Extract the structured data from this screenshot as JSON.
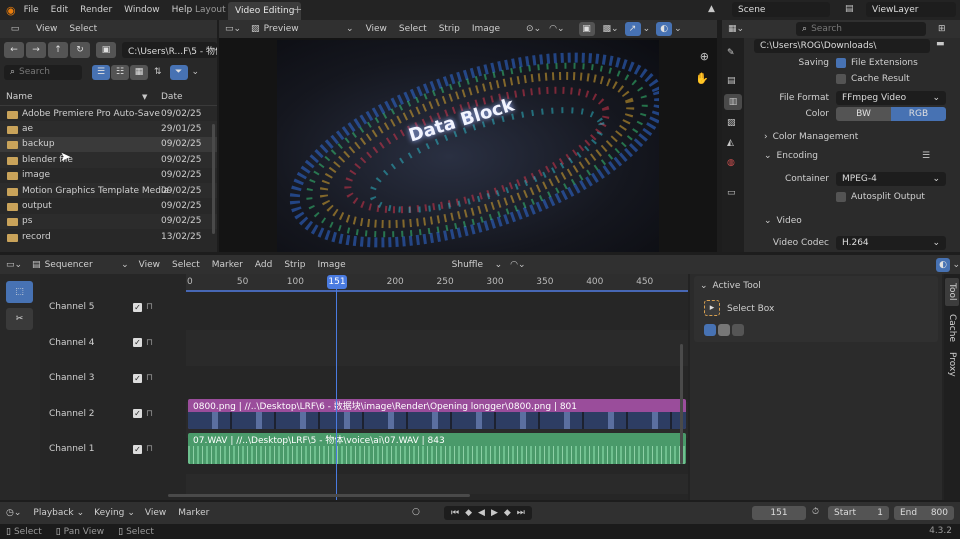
{
  "topbar": {
    "menus": [
      "File",
      "Edit",
      "Render",
      "Window",
      "Help"
    ],
    "workspaces": [
      "Layout",
      "Video Editing"
    ],
    "add_tab": "+",
    "scene": "Scene",
    "view_layer": "ViewLayer"
  },
  "filebrowser": {
    "menus": [
      "View",
      "Select"
    ],
    "path": "C:\\Users\\R...F\\5 - 物体\\",
    "search_placeholder": "Search",
    "col_name": "Name",
    "col_date": "Date",
    "files": [
      {
        "name": "Adobe Premiere Pro Auto-Save",
        "date": "09/02/25"
      },
      {
        "name": "ae",
        "date": "29/01/25"
      },
      {
        "name": "backup",
        "date": "09/02/25"
      },
      {
        "name": "blender file",
        "date": "09/02/25"
      },
      {
        "name": "image",
        "date": "09/02/25"
      },
      {
        "name": "Motion Graphics Template Media",
        "date": "09/02/25"
      },
      {
        "name": "output",
        "date": "09/02/25"
      },
      {
        "name": "ps",
        "date": "09/02/25"
      },
      {
        "name": "record",
        "date": "13/02/25"
      }
    ]
  },
  "preview": {
    "mode": "Preview",
    "menus": [
      "View",
      "Select",
      "Strip",
      "Image"
    ],
    "title_text": "Data Block"
  },
  "properties": {
    "search_placeholder": "Search",
    "output_path": "C:\\Users\\ROG\\Downloads\\",
    "saving_label": "Saving",
    "file_extensions": "File Extensions",
    "cache_result": "Cache Result",
    "file_format_label": "File Format",
    "file_format_value": "FFmpeg Video",
    "color_label": "Color",
    "color_bw": "BW",
    "color_rgb": "RGB",
    "color_management": "Color Management",
    "encoding": "Encoding",
    "container_label": "Container",
    "container_value": "MPEG-4",
    "autosplit": "Autosplit Output",
    "video": "Video",
    "video_codec_label": "Video Codec",
    "video_codec_value": "H.264"
  },
  "sequencer": {
    "mode": "Sequencer",
    "menus": [
      "View",
      "Select",
      "Marker",
      "Add",
      "Strip",
      "Image"
    ],
    "overlap_mode": "Shuffle",
    "ruler": [
      "0",
      "50",
      "100",
      "151",
      "200",
      "250",
      "300",
      "350",
      "400",
      "450"
    ],
    "current_frame_label": "151",
    "channels": [
      "Channel 5",
      "Channel 4",
      "Channel 3",
      "Channel 2",
      "Channel 1"
    ],
    "image_strip": "0800.png | //..\\Desktop\\LRF\\6 - 数据块\\image\\Render\\Opening longger\\0800.png | 801",
    "audio_strip": "07.WAV | //..\\Desktop\\LRF\\5 - 物体\\voice\\ai\\07.WAV | 843",
    "active_tool": "Active Tool",
    "select_box": "Select Box",
    "side_tabs": [
      "Tool",
      "Cache",
      "Proxy"
    ]
  },
  "timeline": {
    "menus": [
      "Playback",
      "Keying",
      "View",
      "Marker"
    ],
    "current_frame": "151",
    "start_label": "Start",
    "start_value": "1",
    "end_label": "End",
    "end_value": "800"
  },
  "statusbar": {
    "items": [
      "Select",
      "Pan View",
      "Select"
    ],
    "version": "4.3.2"
  }
}
